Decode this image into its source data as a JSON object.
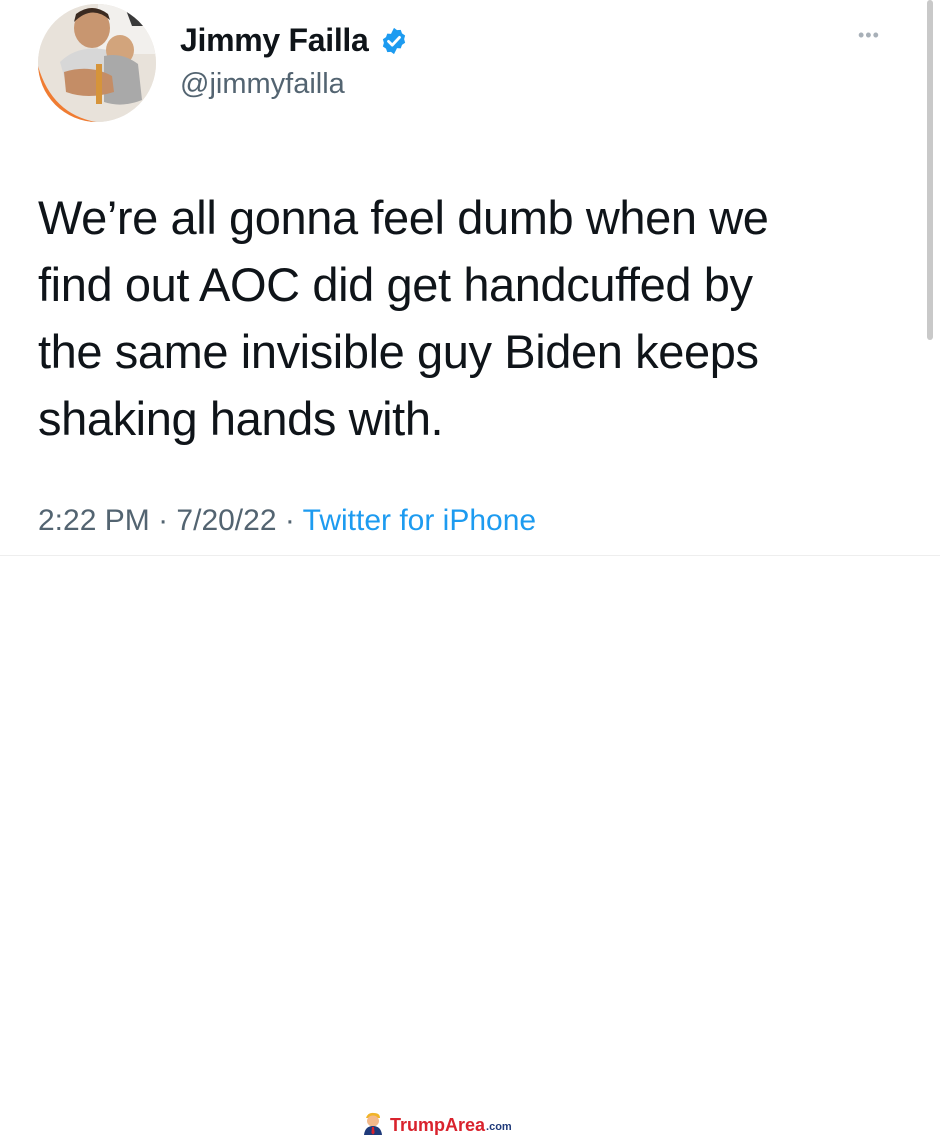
{
  "author": {
    "display_name": "Jimmy Failla",
    "handle": "@jimmyfailla",
    "verified_icon": "verified-badge-icon",
    "verified_color": "#1d9bf0"
  },
  "tweet": {
    "lines": [
      "We’re all gonna feel dumb when we",
      "find out AOC did get handcuffed by",
      "the same invisible guy Biden keeps",
      "shaking hands with."
    ],
    "time": "2:22 PM",
    "separator": "·",
    "date": "7/20/22",
    "source": "Twitter for iPhone"
  },
  "menu": {
    "icon": "more-options-icon",
    "glyph": "•••"
  },
  "watermark": {
    "brand": "TrumpArea",
    "suffix": ".com",
    "icon": "trump-mascot-icon",
    "brand_color": "#d9232d"
  }
}
